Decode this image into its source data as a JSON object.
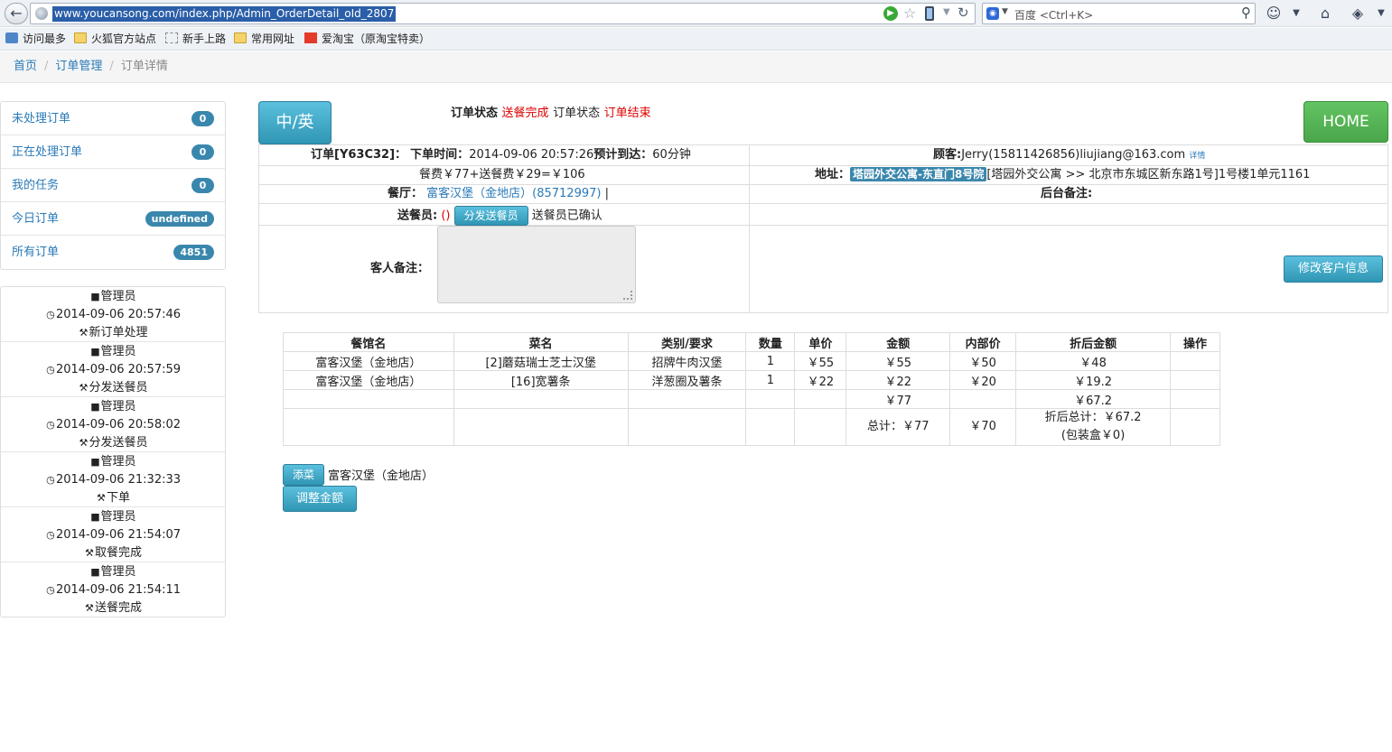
{
  "browser": {
    "url": "www.youcansong.com/index.php/Admin_OrderDetail_oId_2807",
    "search_placeholder": "百度 <Ctrl+K>",
    "bookmarks": [
      "访问最多",
      "火狐官方站点",
      "新手上路",
      "常用网址",
      "爱淘宝（原淘宝特卖）"
    ]
  },
  "breadcrumb": {
    "home": "首页",
    "orders": "订单管理",
    "current": "订单详情"
  },
  "menu": [
    {
      "label": "未处理订单",
      "badge": "0"
    },
    {
      "label": "正在处理订单",
      "badge": "0"
    },
    {
      "label": "我的任务",
      "badge": "0"
    },
    {
      "label": "今日订单",
      "badge": "undefined"
    },
    {
      "label": "所有订单",
      "badge": "4851"
    }
  ],
  "log": [
    {
      "user": "管理员",
      "time": "2014-09-06 20:57:46",
      "action": "新订单处理"
    },
    {
      "user": "管理员",
      "time": "2014-09-06 20:57:59",
      "action": "分发送餐员"
    },
    {
      "user": "管理员",
      "time": "2014-09-06 20:58:02",
      "action": "分发送餐员"
    },
    {
      "user": "管理员",
      "time": "2014-09-06 21:32:33",
      "action": "下单"
    },
    {
      "user": "管理员",
      "time": "2014-09-06 21:54:07",
      "action": "取餐完成"
    },
    {
      "user": "管理员",
      "time": "2014-09-06 21:54:11",
      "action": "送餐完成"
    }
  ],
  "lang_button": "中/英",
  "home_button": "HOME",
  "status": {
    "label1": "订单状态",
    "value1": "送餐完成",
    "label2": "订单状态",
    "value2": "订单结束"
  },
  "order": {
    "id_label": "订单[Y63C32]：",
    "time_label": "下单时间：",
    "time_value": "2014-09-06 20:57:26",
    "eta_label": "预计到达：",
    "eta_value": "60分钟",
    "fee": "餐费￥77+送餐费￥29=￥106",
    "restaurant_label": "餐厅：",
    "restaurant_value": "富客汉堡（金地店）(85712997)",
    "restaurant_sep": "|",
    "courier_label": "送餐员:",
    "courier_value": "()",
    "dispatch_button": "分发送餐员",
    "courier_status": "送餐员已确认",
    "guest_note_label": "客人备注：",
    "customer_label": "顾客:",
    "customer_value": "Jerry(15811426856)liujiang@163.com",
    "customer_detail": "详情",
    "address_label": "地址：",
    "address_tag": "塔园外交公寓-东直门8号院",
    "address_value": "[塔园外交公寓 >> 北京市东城区新东路1号]1号楼1单元1161",
    "backend_note_label": "后台备注:",
    "edit_button": "修改客户信息"
  },
  "table": {
    "headers": [
      "餐馆名",
      "菜名",
      "类别/要求",
      "数量",
      "单价",
      "金额",
      "内部价",
      "折后金额",
      "操作"
    ],
    "rows": [
      [
        "富客汉堡（金地店）",
        "[2]蘑菇瑞士芝士汉堡",
        "招牌牛肉汉堡",
        "1",
        "￥55",
        "￥55",
        "￥50",
        "￥48",
        ""
      ],
      [
        "富客汉堡（金地店）",
        "[16]宽薯条",
        "洋葱圈及薯条",
        "1",
        "￥22",
        "￥22",
        "￥20",
        "￥19.2",
        ""
      ]
    ],
    "subtotal": {
      "amount": "￥77",
      "discounted": "￥67.2"
    },
    "total": {
      "amount": "总计：￥77",
      "internal": "￥70",
      "discounted": "折后总计：￥67.2",
      "box": "(包装盒￥0)"
    }
  },
  "footer": {
    "add_dish_button": "添菜",
    "store_label": "富客汉堡（金地店）",
    "adjust_button": "调整金额"
  }
}
